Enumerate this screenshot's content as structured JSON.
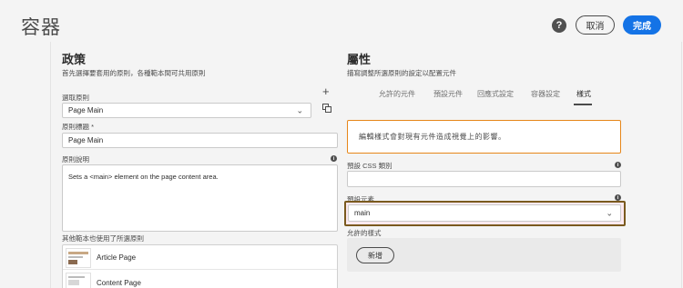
{
  "header": {
    "title": "容器",
    "help_label": "?",
    "cancel_label": "取消",
    "done_label": "完成"
  },
  "policy": {
    "title": "政策",
    "description": "首先選擇要套用的原則，各種範本間可共用原則",
    "select_label": "選取原則",
    "select_value": "Page Main",
    "add_label": "+",
    "title_label": "原則標題 *",
    "title_value": "Page Main",
    "desc_label": "原則說明",
    "desc_value": "Sets a <main> element on the page content area.",
    "info_label": "i",
    "used_by_label": "其他範本也使用了所選原則",
    "used_by": [
      {
        "label": "Article Page"
      },
      {
        "label": "Content Page"
      }
    ]
  },
  "properties": {
    "title": "屬性",
    "description": "描寫調整所選原則的設定以配置元件",
    "tabs": [
      {
        "label": "允許的元件"
      },
      {
        "label": "預設元件"
      },
      {
        "label": "回應式設定"
      },
      {
        "label": "容器設定"
      },
      {
        "label": "樣式"
      }
    ],
    "notice": "編輯樣式會對現有元件造成視覺上的影響。",
    "default_css_label": "預設 CSS 類別",
    "default_css_value": "",
    "default_element_label": "預設元素",
    "default_element_value": "main",
    "allowed_styles_label": "允許的樣式",
    "add_button_label": "新增",
    "info_label": "i"
  },
  "colors": {
    "accent": "#1473e6",
    "notice_border": "#e68619",
    "highlight_border": "#7a5a1e"
  }
}
